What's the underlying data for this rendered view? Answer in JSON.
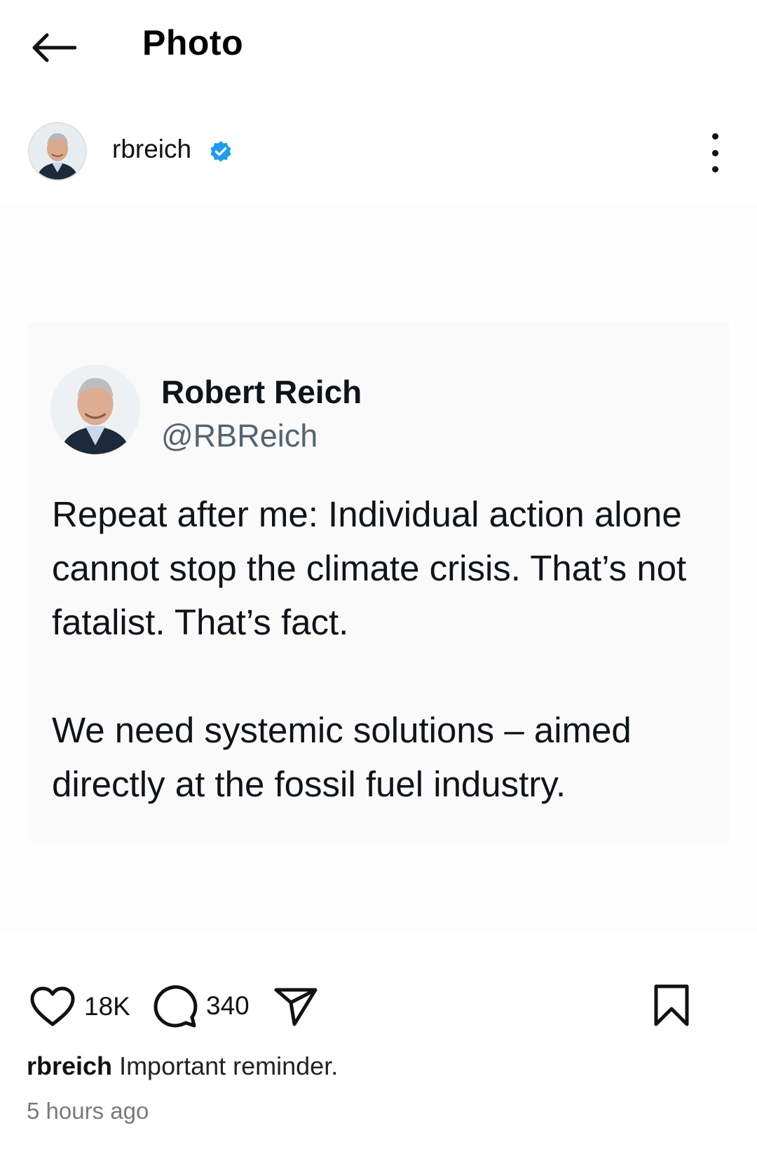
{
  "topbar": {
    "title": "Photo",
    "back_icon": "arrow-left-icon"
  },
  "post": {
    "username": "rbreich",
    "verified": true,
    "more_icon": "more-vertical-icon"
  },
  "tweet": {
    "name": "Robert Reich",
    "handle": "@RBReich",
    "paragraph1": "Repeat after me: Individual action alone cannot stop the climate crisis. That’s not fatalist. That’s fact.",
    "paragraph2": "We need systemic solutions – aimed directly at the fossil fuel industry."
  },
  "actions": {
    "likes": "18K",
    "comments": "340",
    "icons": [
      "heart-icon",
      "comment-icon",
      "send-icon",
      "bookmark-icon"
    ]
  },
  "caption": {
    "username": "rbreich",
    "text": "Important reminder."
  },
  "timestamp": "5 hours ago",
  "colors": {
    "verified": "#1d9bf0",
    "handle": "#536471",
    "timestamp": "#7a7a7a"
  }
}
